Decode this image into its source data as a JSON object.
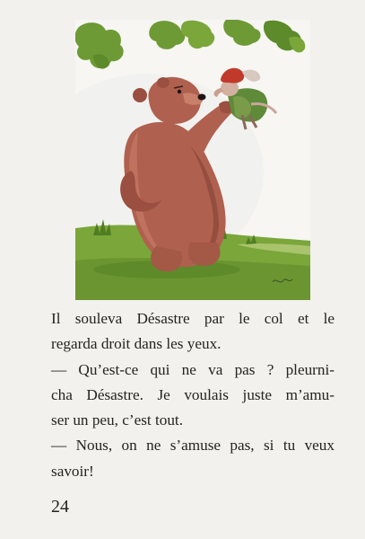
{
  "page": {
    "paragraphs": [
      {
        "lines": [
          "Il souleva Désastre par le col et le",
          "regarda droit dans les yeux."
        ]
      },
      {
        "lines": [
          "— Qu’est-ce qui ne va pas ? pleurni-",
          "cha Désastre. Je voulais juste m’amu-",
          "ser un peu, c’est tout."
        ]
      },
      {
        "lines": [
          "— Nous, on ne s’amuse pas, si tu veux",
          "savoir!"
        ]
      }
    ],
    "page_number": "24"
  },
  "illustration": {
    "subject": "bear-lifting-goblin",
    "colors": {
      "bear": "#b0604f",
      "bear_shadow": "#7e3f35",
      "grass": "#7aa63a",
      "leaves": "#6d9a35",
      "hat": "#c0392b",
      "sky": "#f6f5f1"
    }
  }
}
